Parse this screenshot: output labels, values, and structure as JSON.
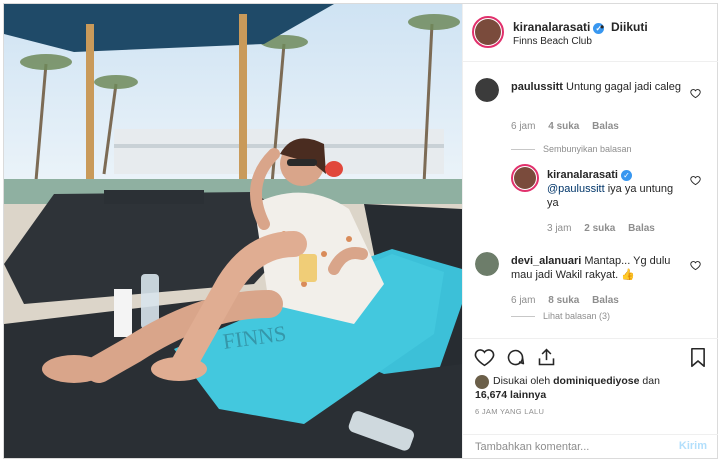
{
  "header": {
    "username": "kiranalarasati",
    "verified_glyph": "✓",
    "separator": "•",
    "follow_status": "Diikuti",
    "location": "Finns Beach Club"
  },
  "comments": [
    {
      "username": "paulussitt",
      "text": "Untung gagal jadi caleg",
      "time": "6 jam",
      "likes": "4 suka",
      "reply_label": "Balas",
      "toggle": "Sembunyikan balasan"
    },
    {
      "username": "kiranalarasati",
      "mention": "@paulussitt",
      "text": " iya ya untung ya",
      "time": "3 jam",
      "likes": "2 suka",
      "reply_label": "Balas"
    },
    {
      "username": "devi_alanuari",
      "text": "Mantap... Yg dulu mau jadi Wakil rakyat.",
      "emoji": "👍",
      "time": "6 jam",
      "likes": "8 suka",
      "reply_label": "Balas",
      "toggle": "Lihat balasan (3)"
    }
  ],
  "likes": {
    "prefix": "Disukai oleh",
    "user": "dominiquediyose",
    "conj": "dan",
    "count": "16,674 lainnya"
  },
  "timestamp": "6 JAM YANG LALU",
  "add_comment": {
    "placeholder": "Tambahkan komentar...",
    "submit": "Kirim"
  },
  "icons": {
    "like": "heart-icon",
    "comment": "comment-icon",
    "share": "share-icon",
    "save": "bookmark-icon"
  },
  "colors": {
    "verified": "#3897f0",
    "story_ring": "#e1306c",
    "post_button_disabled": "#b2dffc",
    "secondary_text": "#8e8e8e"
  }
}
